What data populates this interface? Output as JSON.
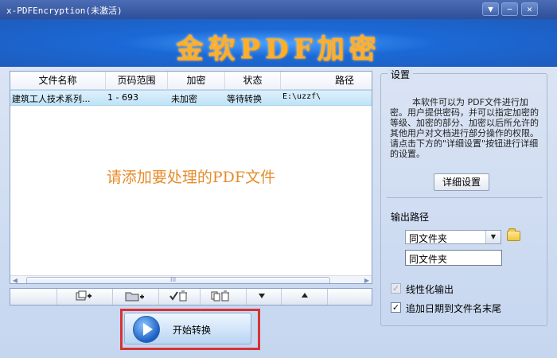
{
  "window": {
    "title": "x-PDFEncryption(未激活)",
    "buttons": [
      "▼",
      "−",
      "✕"
    ]
  },
  "banner": {
    "logo_text": "金软PDF加密"
  },
  "file_table": {
    "columns": [
      "文件名称",
      "页码范围",
      "加密",
      "状态",
      "路径"
    ],
    "rows": [
      {
        "name": "建筑工人技术系列...",
        "range": "1 - 693",
        "encrypt": "未加密",
        "status": "等待转换",
        "path": "E:\\uzzf\\"
      }
    ],
    "hint": "请添加要处理的PDF文件"
  },
  "scrollbar": {
    "grip": "III"
  },
  "start_button": {
    "label": "开始转换"
  },
  "settings": {
    "legend": "设置",
    "description": "本软件可以为 PDF文件进行加密。用户提供密码，并可以指定加密的等级、加密的部分、加密以后所允许的其他用户对文档进行部分操作的权限。请点击下方的\"详细设置\"按钮进行详细的设置。",
    "detail_button": "详细设置",
    "output_path_label": "输出路径",
    "output_select": "同文件夹",
    "output_field": "同文件夹",
    "linearize_label": "线性化输出",
    "append_date_label": "追加日期到文件名末尾"
  }
}
